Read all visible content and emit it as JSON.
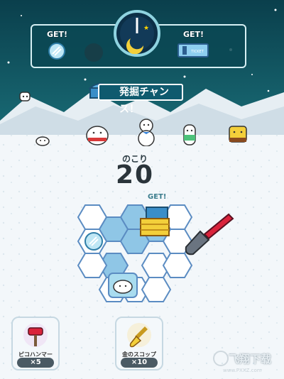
{
  "header": {
    "get_left_label": "GET!",
    "get_right_label": "GET!",
    "ticket_text": "TICKET"
  },
  "banner": {
    "text": "発掘チャンス！"
  },
  "counter": {
    "label": "のこり",
    "value": "20"
  },
  "grid_get_label": "GET!",
  "tools": [
    {
      "name": "ピコハンマー",
      "count": "×5",
      "icon": "red-hammer-icon"
    },
    {
      "name": "金のスコップ",
      "count": "×10",
      "icon": "gold-shovel-icon"
    }
  ],
  "watermark": {
    "text": "飞翔下载",
    "url": "www.PXXZ.com"
  },
  "colors": {
    "sky": "#0d4b57",
    "snow": "#f3f7fa",
    "hex_dug": "#8fc6e6",
    "hex_line": "#5b8cc2",
    "shovel_red": "#d9233b"
  }
}
